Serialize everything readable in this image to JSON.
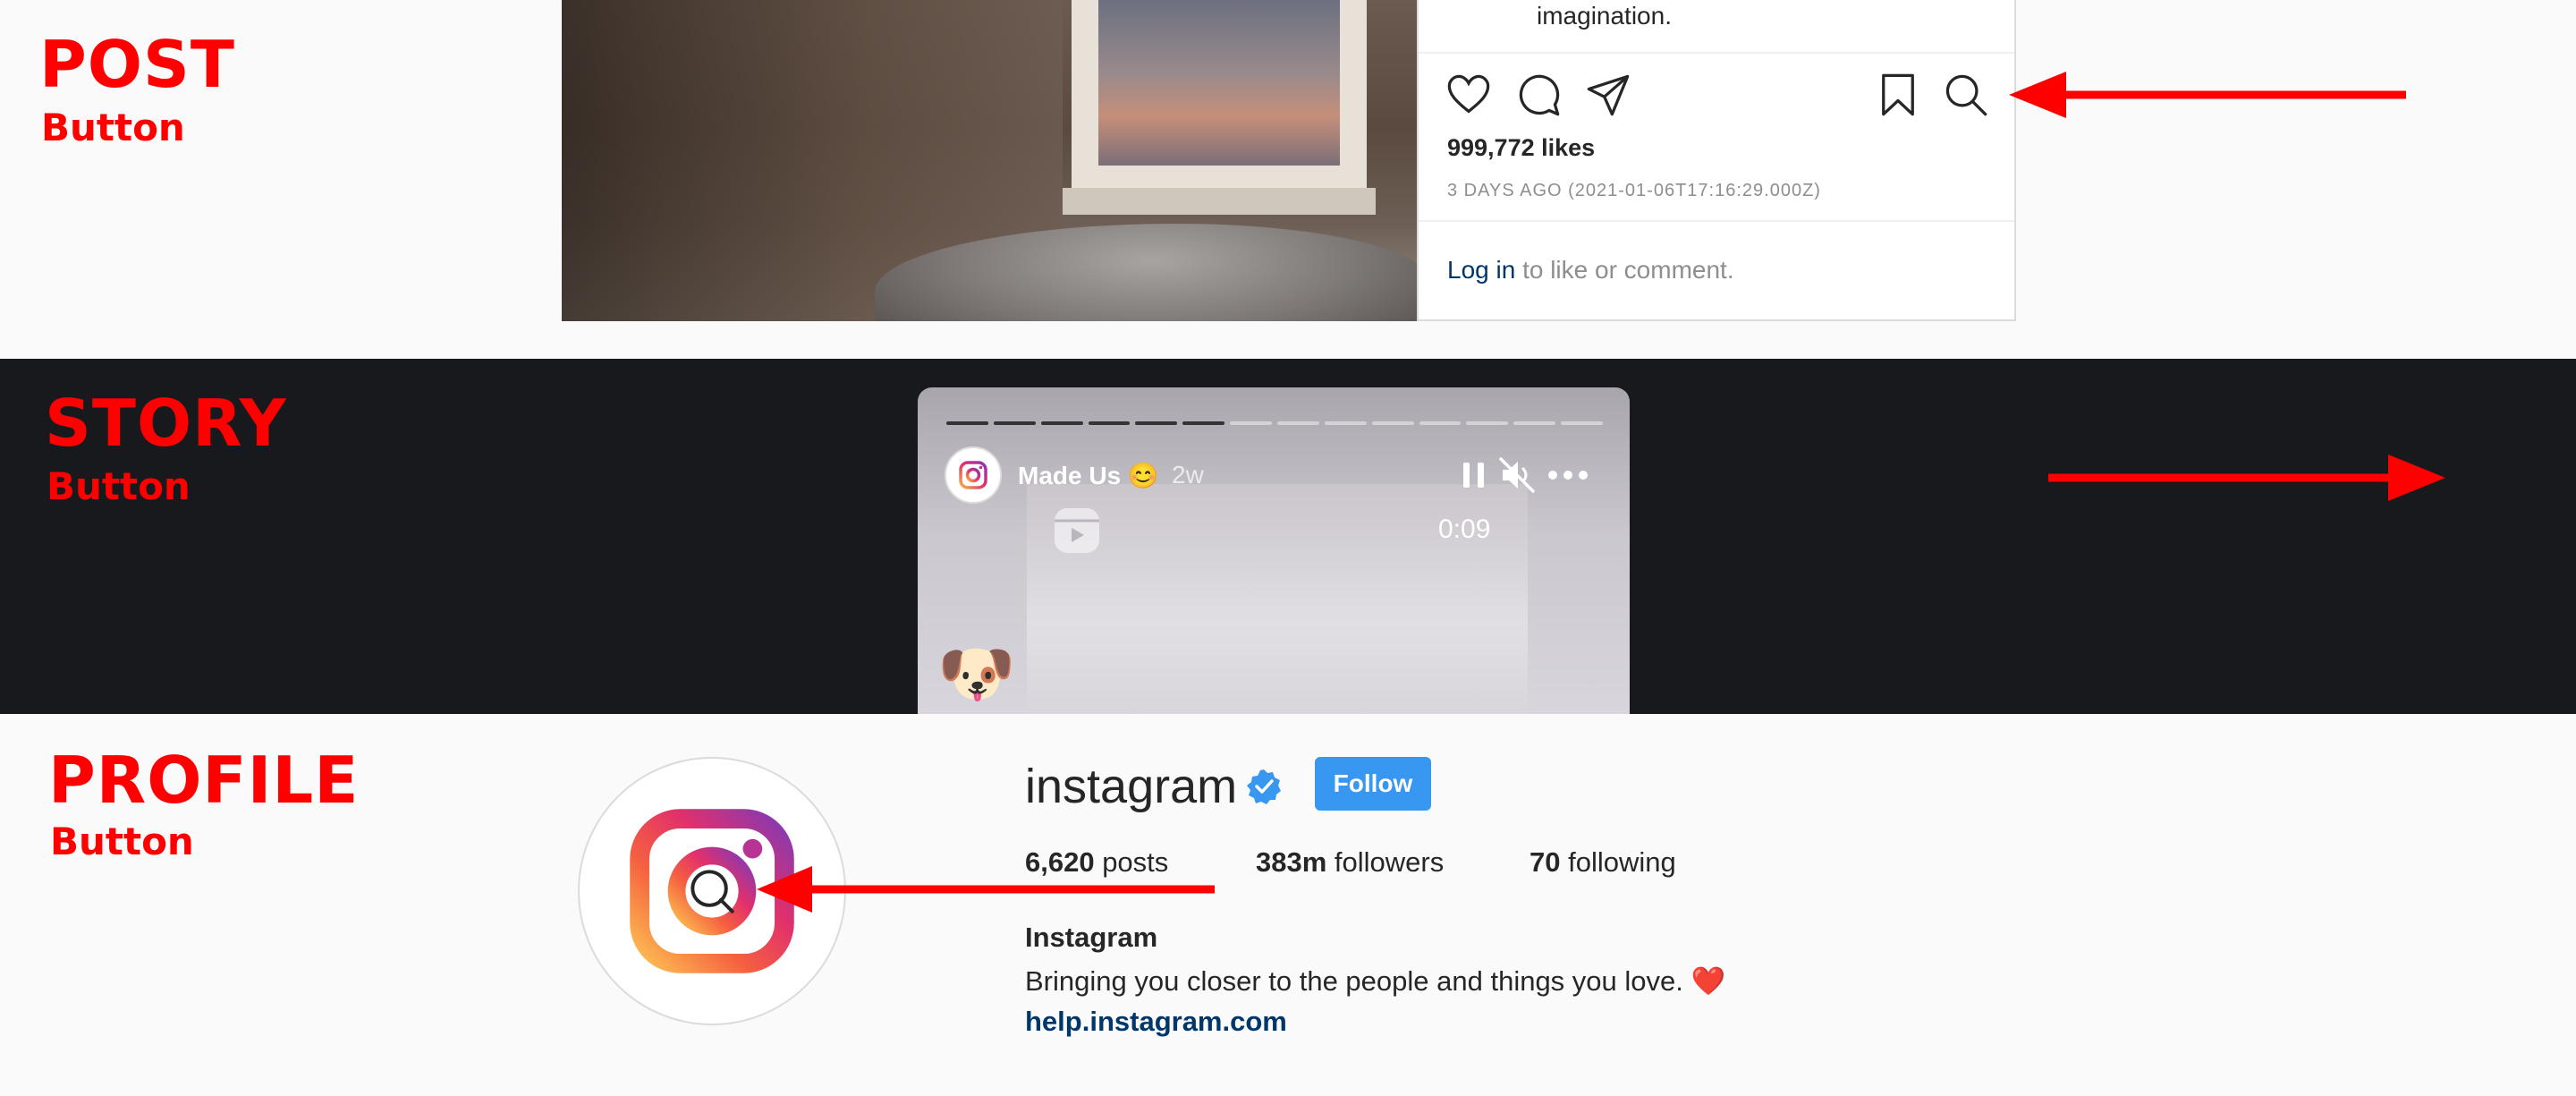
{
  "post": {
    "annotation_title": "POST",
    "annotation_sub": "Button",
    "caption": "imagination.",
    "likes": "999,772 likes",
    "timestamp": "3 DAYS AGO (2021-01-06T17:16:29.000Z)",
    "login_link": "Log in",
    "login_rest": " to like or comment.",
    "icons": [
      "heart-icon",
      "comment-icon",
      "share-icon",
      "bookmark-icon",
      "search-icon"
    ]
  },
  "story": {
    "annotation_title": "STORY",
    "annotation_sub": "Button",
    "username": "Made Us 😊",
    "time": "2w",
    "timer": "0:09",
    "progress_segments": 14,
    "progress_done": 6,
    "icons": [
      "pause-icon",
      "mute-icon",
      "more-icon",
      "close-icon",
      "external-link-icon",
      "reel-icon"
    ]
  },
  "profile": {
    "annotation_title": "PROFILE",
    "annotation_sub": "Button",
    "username": "instagram",
    "follow_label": "Follow",
    "posts_count": "6,620",
    "posts_label": " posts",
    "followers_count": "383m",
    "followers_label": " followers",
    "following_count": "70",
    "following_label": " following",
    "name": "Instagram",
    "bio": "Bringing you closer to the people and things you love. ❤️",
    "link": "help.instagram.com"
  },
  "colors": {
    "annotation": "#ff0000",
    "follow": "#3897f0",
    "link": "#00376b"
  }
}
